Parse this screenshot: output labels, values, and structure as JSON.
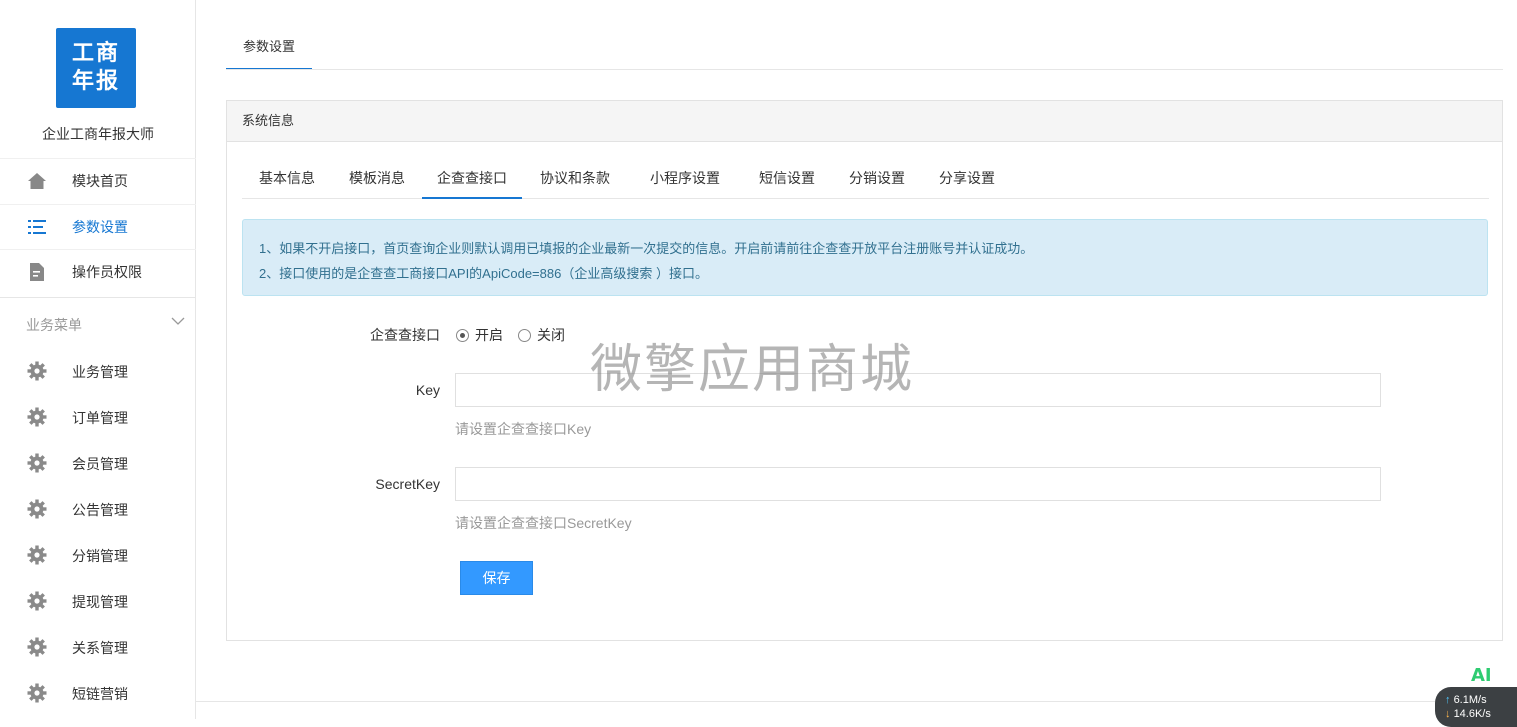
{
  "sidebar": {
    "logo_line1": "工商",
    "logo_line2": "年报",
    "app_name": "企业工商年报大师",
    "nav": [
      {
        "label": "模块首页",
        "icon": "home-icon"
      },
      {
        "label": "参数设置",
        "icon": "list-icon",
        "active": true
      },
      {
        "label": "操作员权限",
        "icon": "document-icon"
      }
    ],
    "group_label": "业务菜单",
    "biz": [
      {
        "label": "业务管理"
      },
      {
        "label": "订单管理"
      },
      {
        "label": "会员管理"
      },
      {
        "label": "公告管理"
      },
      {
        "label": "分销管理"
      },
      {
        "label": "提现管理"
      },
      {
        "label": "关系管理"
      },
      {
        "label": "短链营销"
      }
    ]
  },
  "main": {
    "top_tab": "参数设置",
    "panel_title": "系统信息",
    "tabs": [
      "基本信息",
      "模板消息",
      "企查查接口",
      "协议和条款",
      "小程序设置",
      "短信设置",
      "分销设置",
      "分享设置"
    ],
    "active_tab": "企查查接口",
    "notice": [
      "1、如果不开启接口，首页查询企业则默认调用已填报的企业最新一次提交的信息。开启前请前往企查查开放平台注册账号并认证成功。",
      "2、接口使用的是企查查工商接口API的ApiCode=886（企业高级搜索 ）接口。"
    ],
    "form": {
      "switch_label": "企查查接口",
      "on_label": "开启",
      "off_label": "关闭",
      "switch_value": "开启",
      "key_label": "Key",
      "key_value": "",
      "key_help": "请设置企查查接口Key",
      "secret_label": "SecretKey",
      "secret_value": "",
      "secret_help": "请设置企查查接口SecretKey",
      "save_label": "保存"
    }
  },
  "watermark": "微擎应用商城",
  "overlay": {
    "ai": "AI",
    "up_speed": "6.1M/s",
    "down_speed": "14.6K/s"
  },
  "colors": {
    "accent": "#1677d2",
    "button": "#3399ff",
    "notice_bg": "#d9ecf7"
  }
}
